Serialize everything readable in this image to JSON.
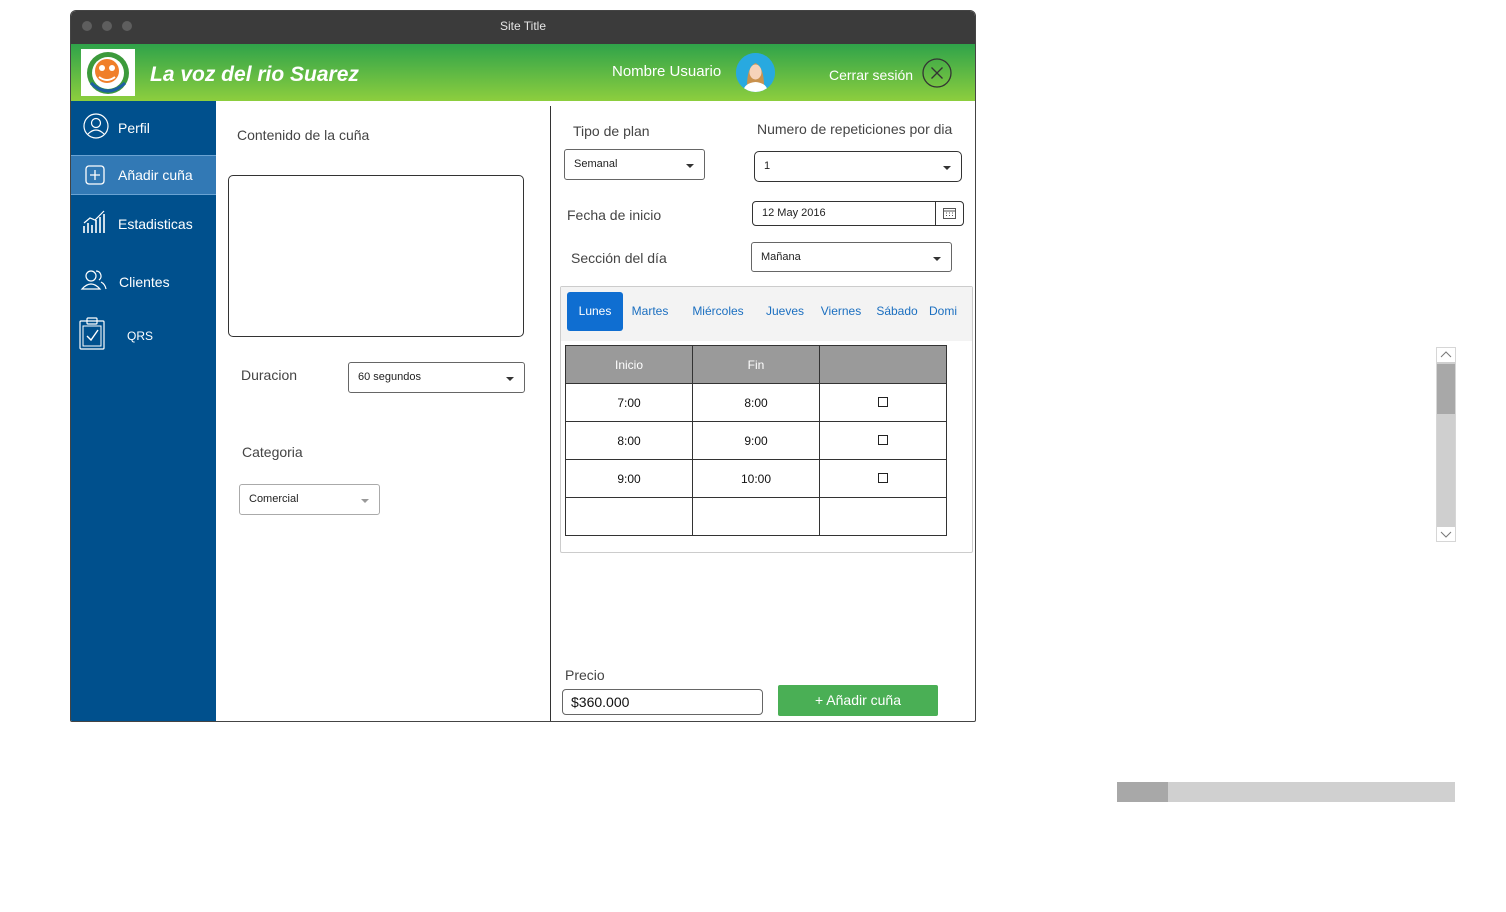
{
  "window": {
    "title": "Site Title"
  },
  "header": {
    "site_name": "La voz del rio Suarez",
    "user_name": "Nombre Usuario",
    "logout_label": "Cerrar sesión"
  },
  "sidebar": {
    "items": [
      {
        "label": "Perfil",
        "icon": "user-icon"
      },
      {
        "label": "Añadir cuña",
        "icon": "plus-square-icon",
        "active": true
      },
      {
        "label": "Estadisticas",
        "icon": "chart-icon"
      },
      {
        "label": "Clientes",
        "icon": "users-icon"
      },
      {
        "label": "QRS",
        "icon": "clipboard-check-icon"
      }
    ]
  },
  "form": {
    "content_label": "Contenido de la cuña",
    "content_value": "",
    "duration_label": "Duracion",
    "duration_value": "60 segundos",
    "category_label": "Categoria",
    "category_value": "Comercial",
    "plan_type_label": "Tipo de plan",
    "plan_type_value": "Semanal",
    "repetitions_label": "Numero de repeticiones por dia",
    "repetitions_value": "1",
    "start_date_label": "Fecha de inicio",
    "start_date_value": "12 May 2016",
    "day_section_label": "Sección del día",
    "day_section_value": "Mañana"
  },
  "days_tabs": [
    "Lunes",
    "Martes",
    "Miércoles",
    "Jueves",
    "Viernes",
    "Sábado",
    "Domi"
  ],
  "active_day": "Lunes",
  "schedule": {
    "headers": [
      "Inicio",
      "Fin",
      ""
    ],
    "rows": [
      {
        "start": "7:00",
        "end": "8:00",
        "checked": false
      },
      {
        "start": "8:00",
        "end": "9:00",
        "checked": false
      },
      {
        "start": "9:00",
        "end": "10:00",
        "checked": false
      },
      {
        "start": "",
        "end": "",
        "checked": null
      }
    ]
  },
  "price": {
    "label": "Precio",
    "value": "$360.000"
  },
  "add_button_label": "+ Añadir cuña",
  "colors": {
    "sidebar_bg": "#00508d",
    "sidebar_active": "#3279b5",
    "header_gradient_start": "#2fa34a",
    "header_gradient_end": "#8dce3e",
    "tab_active": "#0f6ed1",
    "add_button": "#4aaf55"
  }
}
